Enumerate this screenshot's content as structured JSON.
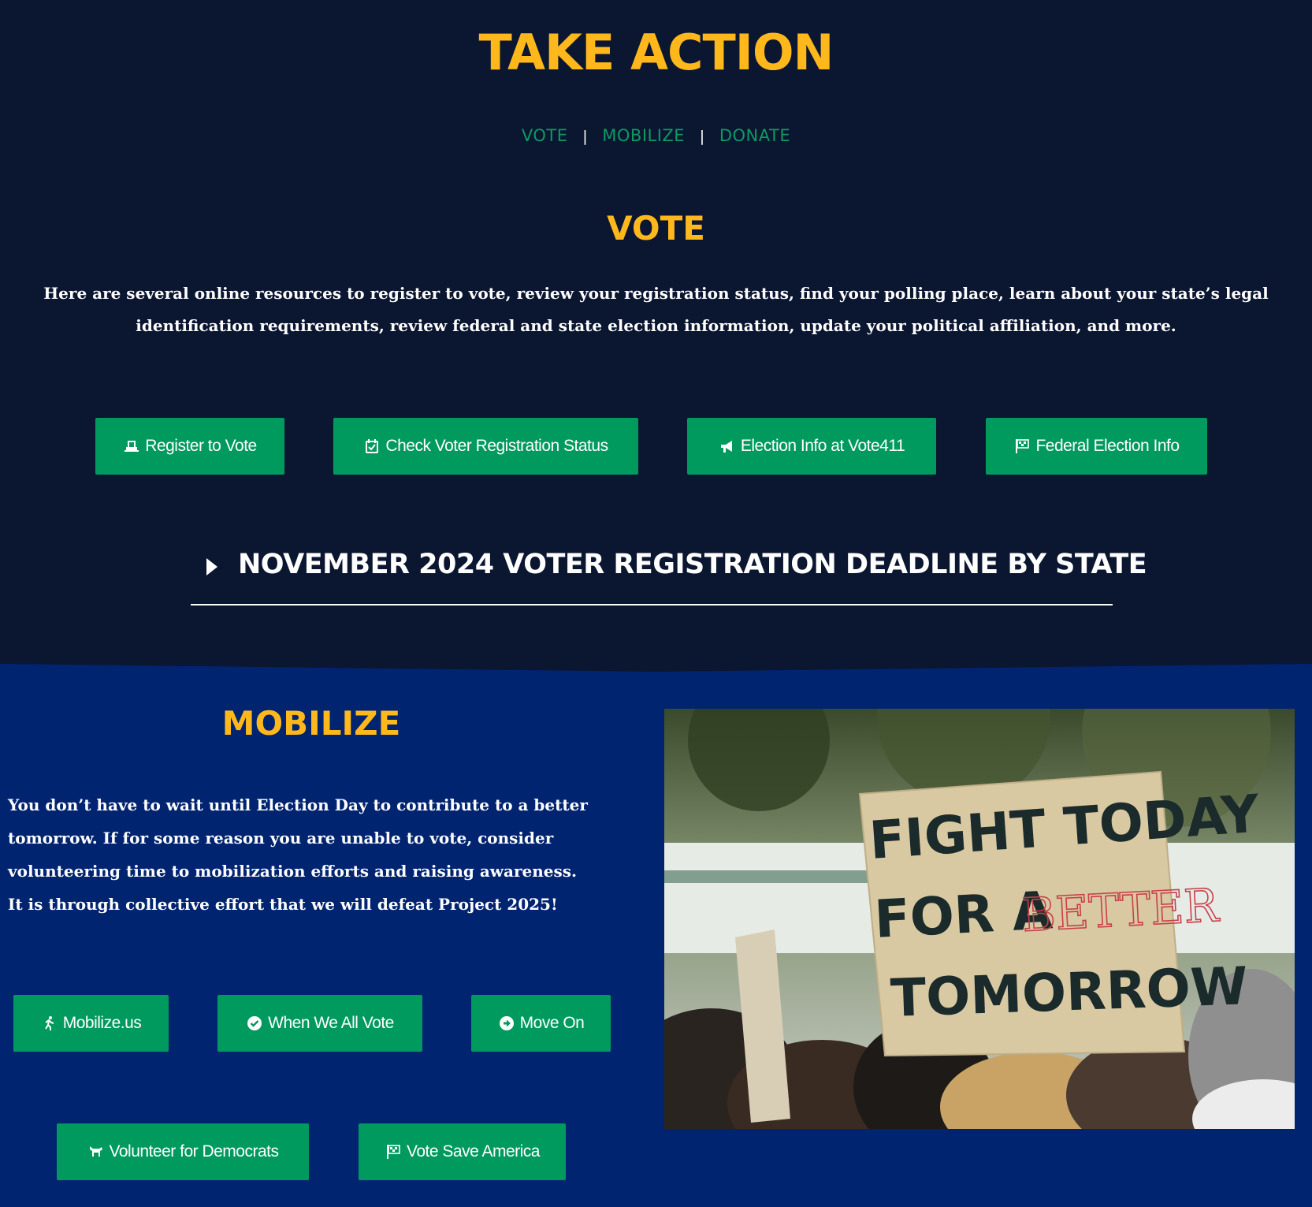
{
  "header": {
    "title": "TAKE ACTION",
    "nav": [
      {
        "label": "VOTE"
      },
      {
        "label": "MOBILIZE"
      },
      {
        "label": "DONATE"
      }
    ],
    "separator": "|"
  },
  "vote": {
    "title": "VOTE",
    "description": "Here are several online resources to register to vote, review your registration status, find your polling place, learn about your state’s legal identification requirements, review federal and state election information, update your political affiliation, and more.",
    "buttons": [
      {
        "label": "Register to Vote",
        "icon": "ballot-box-icon"
      },
      {
        "label": "Check Voter Registration Status",
        "icon": "calendar-check-icon"
      },
      {
        "label": "Election Info at Vote411",
        "icon": "megaphone-icon"
      },
      {
        "label": "Federal Election Info",
        "icon": "flag-icon"
      }
    ],
    "accordion_title": "NOVEMBER 2024 VOTER REGISTRATION DEADLINE BY STATE"
  },
  "mobilize": {
    "title": "MOBILIZE",
    "description": "You don’t have to wait until Election Day to contribute to a better tomorrow. If for some reason you are unable to vote, consider volunteering time to mobilization efforts and raising awareness. It is through collective effort that we will defeat Project 2025!",
    "buttons": [
      {
        "label": "Mobilize.us",
        "icon": "running-person-icon"
      },
      {
        "label": "When We All Vote",
        "icon": "check-circle-icon"
      },
      {
        "label": "Move On",
        "icon": "arrow-circle-icon"
      },
      {
        "label": "Volunteer for Democrats",
        "icon": "donkey-icon"
      },
      {
        "label": "Vote Save America",
        "icon": "flag-icon"
      }
    ],
    "photo_sign": {
      "line1": "FIGHT TODAY",
      "line2_a": "FOR A",
      "line2_b": "BETTER",
      "line3": "TOMORROW"
    }
  },
  "colors": {
    "dark_bg": "#0b1631",
    "blue_bg": "#002470",
    "accent_gold": "#ffb81c",
    "button_green": "#009a5f",
    "link_green": "#0d9a63"
  }
}
